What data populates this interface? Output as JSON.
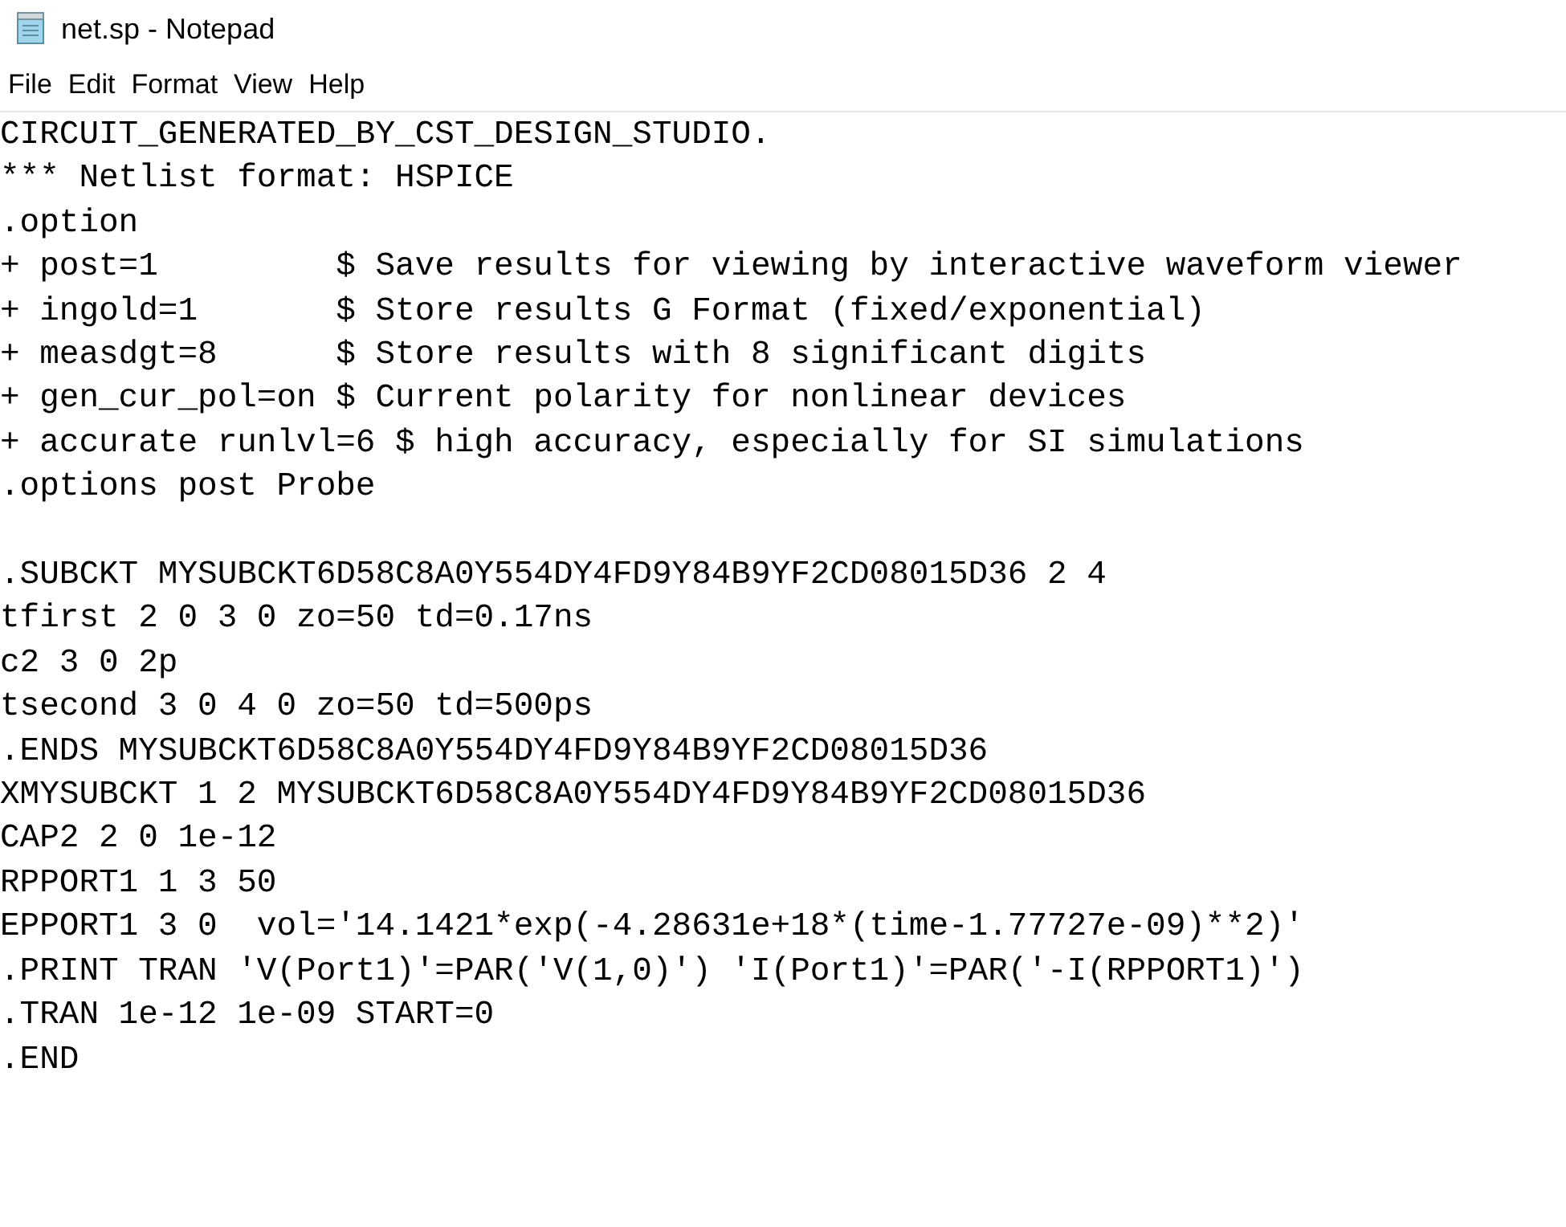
{
  "window": {
    "title": "net.sp - Notepad"
  },
  "menu": [
    "File",
    "Edit",
    "Format",
    "View",
    "Help"
  ],
  "editor": {
    "blocks": [
      [
        "CIRCUIT_GENERATED_BY_CST_DESIGN_STUDIO.",
        "*** Netlist format: HSPICE",
        ".option",
        "+ post=1         $ Save results for viewing by interactive waveform viewer",
        "+ ingold=1       $ Store results G Format (fixed/exponential)",
        "+ measdgt=8      $ Store results with 8 significant digits",
        "+ gen_cur_pol=on $ Current polarity for nonlinear devices",
        "+ accurate runlvl=6 $ high accuracy, especially for SI simulations",
        ".options post Probe"
      ],
      [
        ".SUBCKT MYSUBCKT6D58C8A0Y554DY4FD9Y84B9YF2CD08015D36 2 4",
        "tfirst 2 0 3 0 zo=50 td=0.17ns",
        "c2 3 0 2p",
        "tsecond 3 0 4 0 zo=50 td=500ps",
        ".ENDS MYSUBCKT6D58C8A0Y554DY4FD9Y84B9YF2CD08015D36",
        "XMYSUBCKT 1 2 MYSUBCKT6D58C8A0Y554DY4FD9Y84B9YF2CD08015D36",
        "CAP2 2 0 1e-12",
        "RPPORT1 1 3 50",
        "EPPORT1 3 0  vol='14.1421*exp(-4.28631e+18*(time-1.77727e-09)**2)'",
        ".PRINT TRAN 'V(Port1)'=PAR('V(1,0)') 'I(Port1)'=PAR('-I(RPPORT1)')",
        ".TRAN 1e-12 1e-09 START=0",
        ".END"
      ]
    ]
  }
}
